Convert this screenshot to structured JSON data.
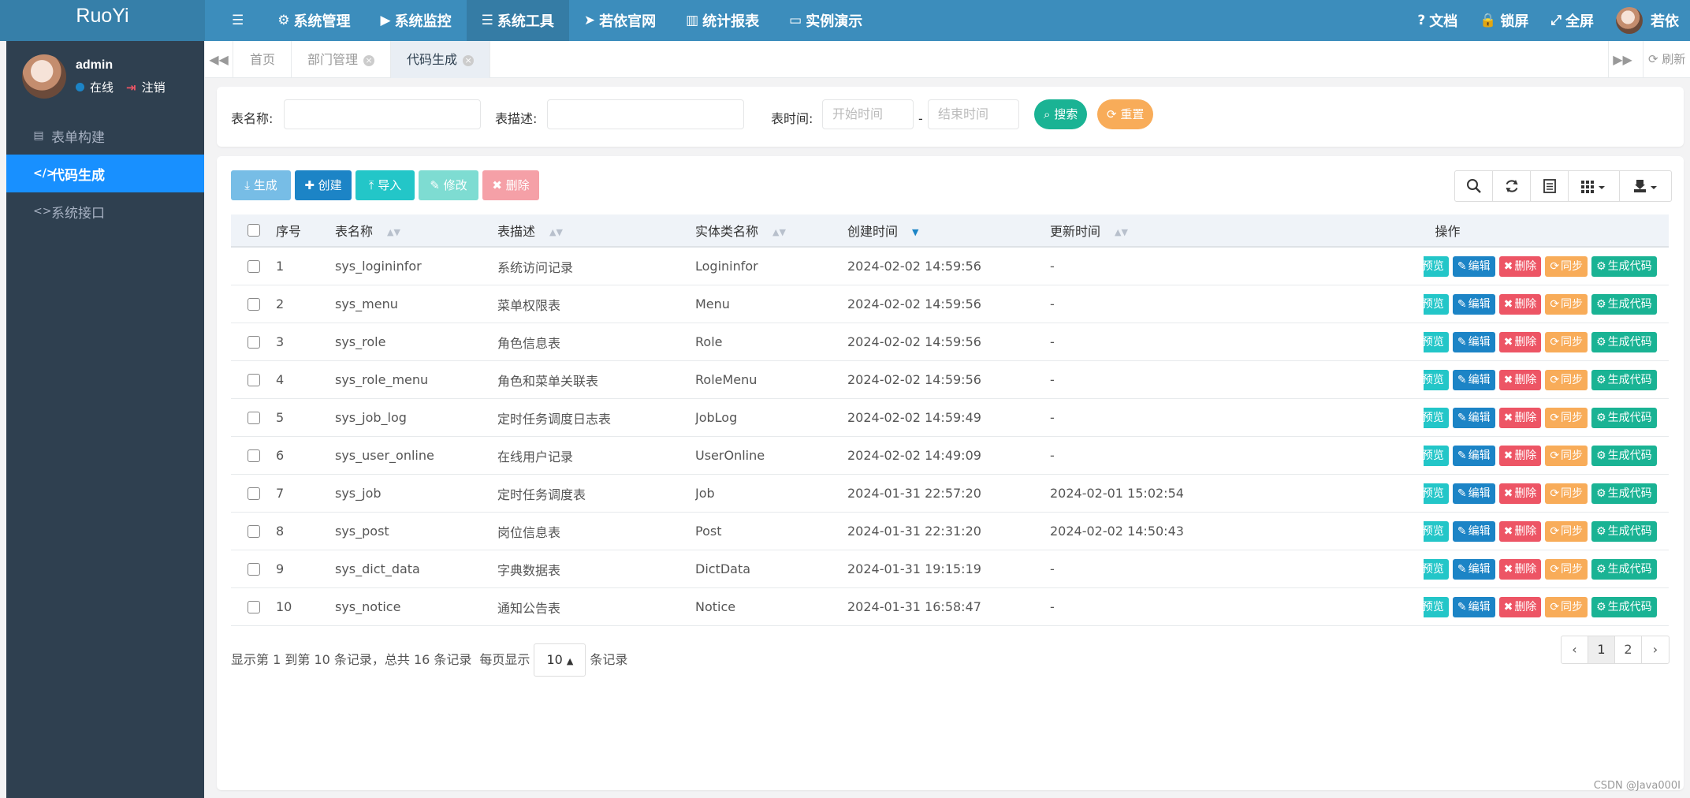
{
  "app": {
    "brand": "RuoYi"
  },
  "topnav": {
    "items": [
      {
        "icon": "☰",
        "label": ""
      },
      {
        "icon": "⚙",
        "label": "系统管理"
      },
      {
        "icon": "▶",
        "label": "系统监控"
      },
      {
        "icon": "☰",
        "label": "系统工具"
      },
      {
        "icon": "➤",
        "label": "若依官网"
      },
      {
        "icon": "▥",
        "label": "统计报表"
      },
      {
        "icon": "▭",
        "label": "实例演示"
      }
    ],
    "right": [
      {
        "icon": "?",
        "label": "文档"
      },
      {
        "icon": "🔒",
        "label": "锁屏"
      },
      {
        "icon": "⤢",
        "label": "全屏"
      },
      {
        "icon": "",
        "label": "若依"
      }
    ]
  },
  "user": {
    "name": "admin",
    "status": "在线",
    "logout": "注销"
  },
  "sidebar": {
    "items": [
      {
        "icon": "▤",
        "label": "表单构建"
      },
      {
        "icon": "</>",
        "label": "代码生成"
      },
      {
        "icon": "<>",
        "label": "系统接口"
      }
    ]
  },
  "tabs": {
    "items": [
      {
        "label": "首页"
      },
      {
        "label": "部门管理"
      },
      {
        "label": "代码生成"
      }
    ],
    "refresh": "刷新",
    "close": "×"
  },
  "search": {
    "table_name_label": "表名称:",
    "table_desc_label": "表描述:",
    "time_label": "表时间:",
    "start_placeholder": "开始时间",
    "dash": "-",
    "end_placeholder": "结束时间",
    "search_btn": "搜索",
    "reset_btn": "重置"
  },
  "toolbar": {
    "generate": "生成",
    "create": "创建",
    "import": "导入",
    "edit": "修改",
    "delete": "删除"
  },
  "table": {
    "headers": {
      "index": "序号",
      "name": "表名称",
      "desc": "表描述",
      "entity": "实体类名称",
      "created": "创建时间",
      "updated": "更新时间",
      "ops": "操作"
    },
    "ops": {
      "preview": "预览",
      "edit": "编辑",
      "delete": "删除",
      "sync": "同步",
      "gen": "生成代码"
    },
    "rows": [
      {
        "index": "1",
        "name": "sys_logininfor",
        "desc": "系统访问记录",
        "entity": "Logininfor",
        "created": "2024-02-02 14:59:56",
        "updated": "-"
      },
      {
        "index": "2",
        "name": "sys_menu",
        "desc": "菜单权限表",
        "entity": "Menu",
        "created": "2024-02-02 14:59:56",
        "updated": "-"
      },
      {
        "index": "3",
        "name": "sys_role",
        "desc": "角色信息表",
        "entity": "Role",
        "created": "2024-02-02 14:59:56",
        "updated": "-"
      },
      {
        "index": "4",
        "name": "sys_role_menu",
        "desc": "角色和菜单关联表",
        "entity": "RoleMenu",
        "created": "2024-02-02 14:59:56",
        "updated": "-"
      },
      {
        "index": "5",
        "name": "sys_job_log",
        "desc": "定时任务调度日志表",
        "entity": "JobLog",
        "created": "2024-02-02 14:59:49",
        "updated": "-"
      },
      {
        "index": "6",
        "name": "sys_user_online",
        "desc": "在线用户记录",
        "entity": "UserOnline",
        "created": "2024-02-02 14:49:09",
        "updated": "-"
      },
      {
        "index": "7",
        "name": "sys_job",
        "desc": "定时任务调度表",
        "entity": "Job",
        "created": "2024-01-31 22:57:20",
        "updated": "2024-02-01 15:02:54"
      },
      {
        "index": "8",
        "name": "sys_post",
        "desc": "岗位信息表",
        "entity": "Post",
        "created": "2024-01-31 22:31:20",
        "updated": "2024-02-02 14:50:43"
      },
      {
        "index": "9",
        "name": "sys_dict_data",
        "desc": "字典数据表",
        "entity": "DictData",
        "created": "2024-01-31 19:15:19",
        "updated": "-"
      },
      {
        "index": "10",
        "name": "sys_notice",
        "desc": "通知公告表",
        "entity": "Notice",
        "created": "2024-01-31 16:58:47",
        "updated": "-"
      }
    ]
  },
  "pagination": {
    "info": "显示第 1 到第 10 条记录，总共 16 条记录",
    "per_page_prefix": "每页显示",
    "page_size": "10",
    "per_page_suffix": "条记录",
    "prev": "‹",
    "pages": [
      "1",
      "2"
    ],
    "next": "›",
    "current": "1"
  },
  "watermark": "CSDN @Java000I",
  "colors": {
    "topbar": "#3c8dbc",
    "sidebar": "#2f4050",
    "active_menu": "#1890ff",
    "cyan": "#23c6c8",
    "blue": "#1c84c6",
    "red": "#ed5565",
    "orange": "#f8ac59",
    "green": "#1ab394"
  }
}
